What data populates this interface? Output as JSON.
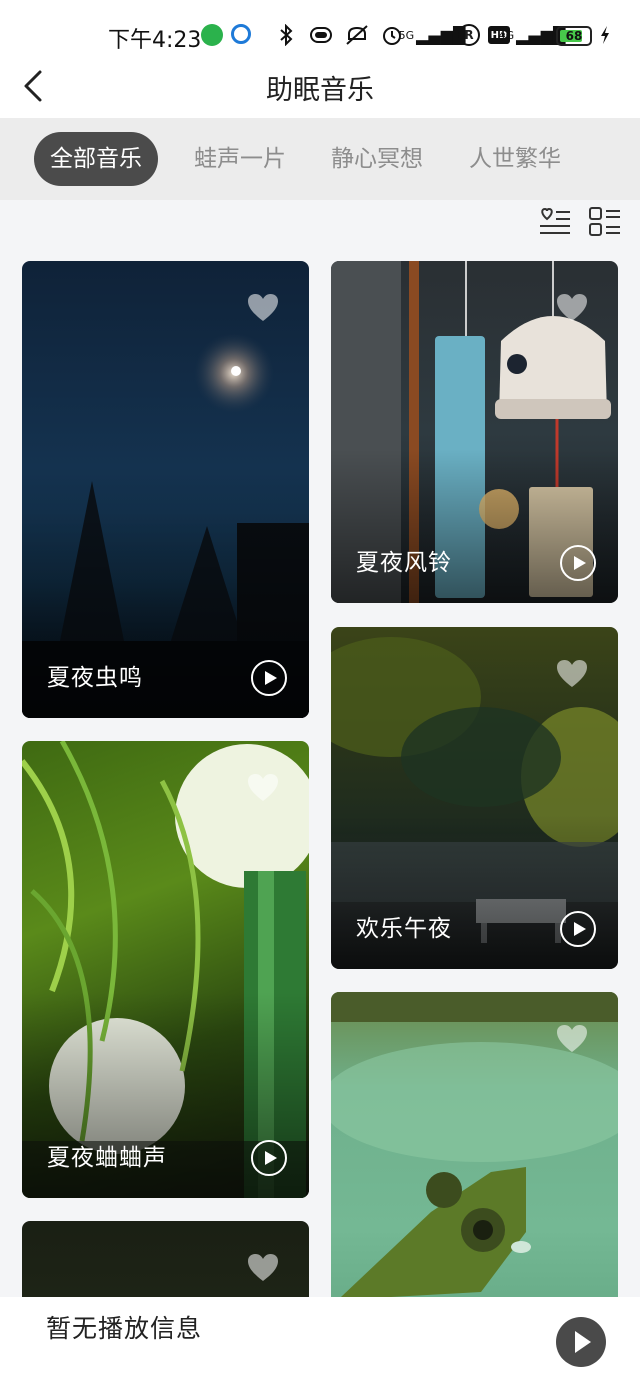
{
  "status_bar": {
    "time": "下午4:23",
    "net_5g": "5G",
    "net_4g": "4G",
    "registered": "R",
    "hd": "HD",
    "battery": "68"
  },
  "header": {
    "title": "助眠音乐"
  },
  "tabs": [
    {
      "label": "全部音乐",
      "active": true
    },
    {
      "label": "蛙声一片",
      "active": false
    },
    {
      "label": "静心冥想",
      "active": false
    },
    {
      "label": "人世繁华",
      "active": false
    }
  ],
  "cards": [
    {
      "title": "夏夜虫鸣"
    },
    {
      "title": "夏夜风铃"
    },
    {
      "title": "欢乐午夜"
    },
    {
      "title": "夏夜蛐蛐声"
    },
    {
      "title": ""
    },
    {
      "title": ""
    }
  ],
  "player": {
    "status": "暂无播放信息"
  },
  "colors": {
    "active_tab_bg": "#4b4b4b",
    "tab_text": "#8d8d8d",
    "page_bg": "#f4f5f7"
  }
}
